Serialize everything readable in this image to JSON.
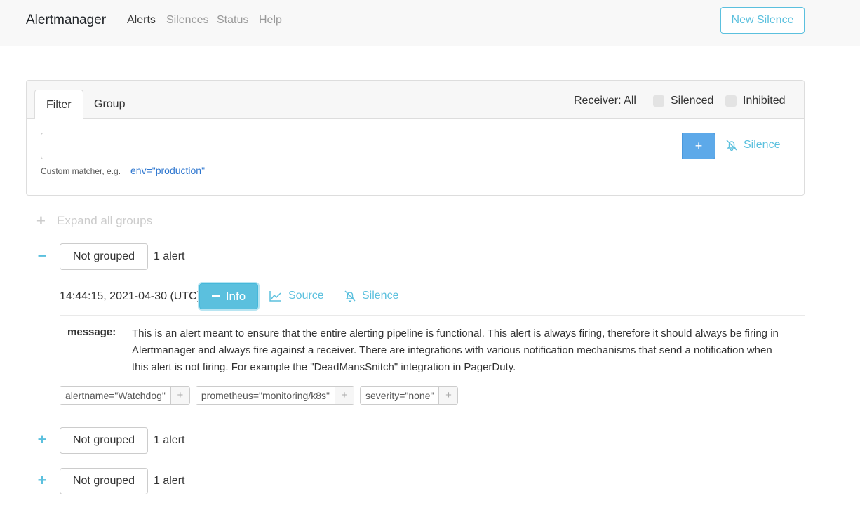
{
  "navbar": {
    "brand": "Alertmanager",
    "links": [
      "Alerts",
      "Silences",
      "Status",
      "Help"
    ],
    "new_silence": "New Silence"
  },
  "filter": {
    "tabs": [
      "Filter",
      "Group"
    ],
    "receiver": "Receiver: All",
    "silenced_label": "Silenced",
    "inhibited_label": "Inhibited",
    "input_value": "",
    "add_button": "+",
    "silence_link": "Silence",
    "hint_text": "Custom matcher, e.g.",
    "hint_example": "env=\"production\""
  },
  "expand_all": {
    "symbol": "+",
    "label": "Expand all groups"
  },
  "groups": [
    {
      "toggle": "−",
      "label": "Not grouped",
      "count": "1 alert"
    },
    {
      "toggle": "+",
      "label": "Not grouped",
      "count": "1 alert"
    },
    {
      "toggle": "+",
      "label": "Not grouped",
      "count": "1 alert"
    }
  ],
  "alert": {
    "time": "14:44:15, 2021-04-30 (UTC)",
    "info_button": "Info",
    "source_link": "Source",
    "silence_link": "Silence",
    "annotation_key": "message:",
    "annotation_value": "This is an alert meant to ensure that the entire alerting pipeline is functional. This alert is always firing, therefore it should always be firing in Alertmanager and always fire against a receiver. There are integrations with various notification mechanisms that send a notification when this alert is not firing. For example the \"DeadMansSnitch\" integration in PagerDuty.",
    "labels": [
      {
        "text": "alertname=\"Watchdog\"",
        "plus": "+"
      },
      {
        "text": "prometheus=\"monitoring/k8s\"",
        "plus": "+"
      },
      {
        "text": "severity=\"none\"",
        "plus": "+"
      }
    ]
  },
  "colors": {
    "accent": "#5bc0de",
    "primary_button": "#5da9e9",
    "link_blue": "#2d76cf"
  }
}
